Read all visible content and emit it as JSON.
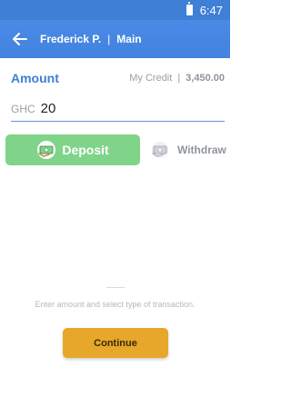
{
  "status_bar": {
    "time": "6:47"
  },
  "app_bar": {
    "name": "Frederick P.",
    "separator": "|",
    "section": "Main"
  },
  "amount": {
    "label": "Amount",
    "credit_label": "My Credit",
    "credit_separator": "|",
    "credit_value": "3,450.00"
  },
  "input": {
    "currency": "GHC",
    "value": "20"
  },
  "actions": {
    "deposit_label": "Deposit",
    "withdraw_label": "Withdraw",
    "deposit_color": "#7fd48a"
  },
  "hint": "Enter amount and select type of transaction.",
  "continue_label": "Continue",
  "colors": {
    "primary": "#4283df",
    "accent": "#e6a72a"
  },
  "icons": [
    "battery-icon",
    "back-arrow-icon",
    "deposit-money-icon",
    "withdraw-money-icon"
  ]
}
